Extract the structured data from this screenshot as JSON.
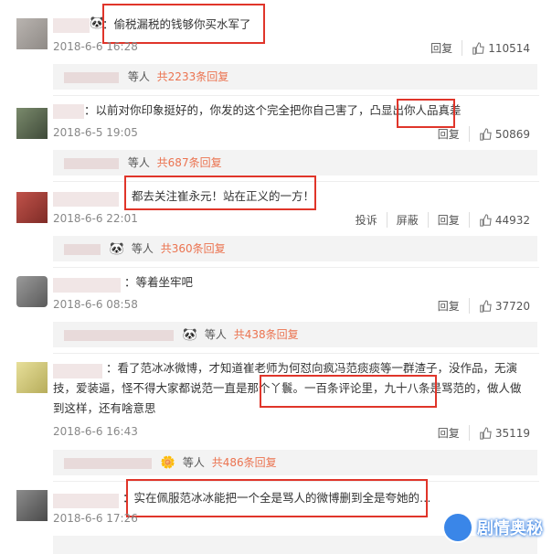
{
  "comments": [
    {
      "text": "：偷税漏税的钱够你买水军了",
      "time": "2018-6-6 16:28",
      "reply": "回复",
      "likes": "110514",
      "sub_suffix": "等人",
      "sub_count": "共2233条回复"
    },
    {
      "text": "：以前对你印象挺好的，你发的这个完全把你自己害了，凸显出你人品真差",
      "time": "2018-6-5 19:05",
      "reply": "回复",
      "likes": "50869",
      "sub_suffix": "等人",
      "sub_count": "共687条回复"
    },
    {
      "text": "都去关注崔永元！站在正义的一方！",
      "time": "2018-6-6 22:01",
      "report": "投诉",
      "block": "屏蔽",
      "reply": "回复",
      "likes": "44932",
      "sub_suffix": "等人",
      "sub_count": "共360条回复"
    },
    {
      "text": "：等着坐牢吧",
      "time": "2018-6-6 08:58",
      "reply": "回复",
      "likes": "37720",
      "sub_suffix": "等人",
      "sub_count": "共438条回复"
    },
    {
      "text": "：看了范冰冰微博，才知道崔老师为何怼向疯冯范痰痰等一群渣子，没作品，无演技，爱装逼，怪不得大家都说范一直是那个丫鬟。一百条评论里，九十八条是骂范的，做人做到这样，还有啥意思",
      "time": "2018-6-6 16:43",
      "reply": "回复",
      "likes": "35119",
      "sub_suffix": "等人",
      "sub_count": "共486条回复"
    },
    {
      "text": "：实在佩服范冰冰能把一个全是骂人的微博删到全是夸她的…",
      "time": "2018-6-6 17:26"
    }
  ],
  "watermark": "剧情奥秘",
  "colors": {
    "highlight": "#e0352a",
    "link": "#eb7350"
  }
}
